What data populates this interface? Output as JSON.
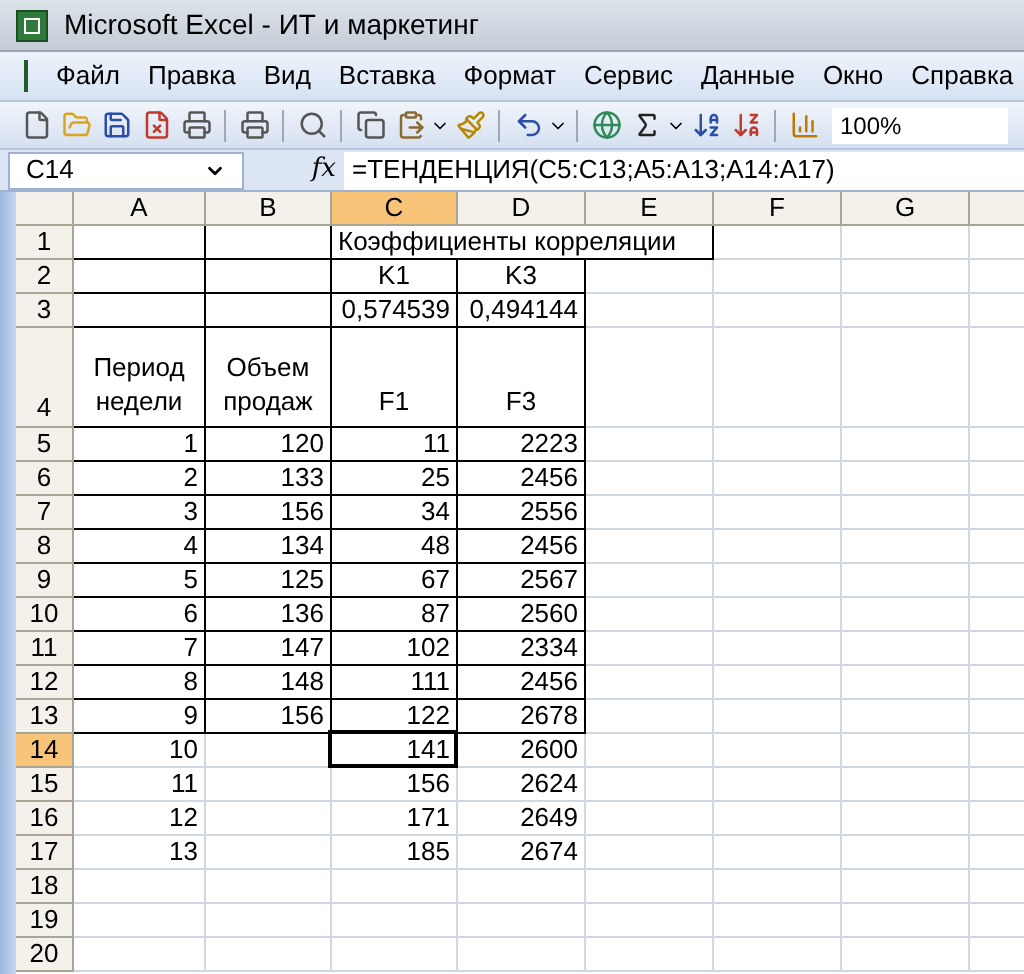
{
  "window": {
    "title": "Microsoft Excel - ИТ и маркетинг"
  },
  "menu": [
    "Файл",
    "Правка",
    "Вид",
    "Вставка",
    "Формат",
    "Сервис",
    "Данные",
    "Окно",
    "Справка"
  ],
  "toolbar": {
    "zoom": "100%"
  },
  "formula_bar": {
    "name_box": "C14",
    "fx": "fx",
    "formula": "=ТЕНДЕНЦИЯ(C5:C13;A5:A13;A14:A17)"
  },
  "columns": [
    {
      "label": "A",
      "selected": false
    },
    {
      "label": "B",
      "selected": false
    },
    {
      "label": "C",
      "selected": true
    },
    {
      "label": "D",
      "selected": false
    },
    {
      "label": "E",
      "selected": false
    },
    {
      "label": "F",
      "selected": false
    },
    {
      "label": "G",
      "selected": false
    }
  ],
  "rows": [
    {
      "number": "1",
      "selected": false,
      "kind": "span",
      "bordered": true,
      "cells": {
        "C": "Коэффициенты корреляции"
      }
    },
    {
      "number": "2",
      "selected": false,
      "kind": "center",
      "bordered": true,
      "cells": {
        "C": "K1",
        "D": "K3"
      }
    },
    {
      "number": "3",
      "selected": false,
      "kind": "number",
      "bordered": true,
      "cells": {
        "C": "0,574539",
        "D": "0,494144"
      }
    },
    {
      "number": "4",
      "selected": false,
      "kind": "tall",
      "bordered": true,
      "cells": {
        "A": "Период недели",
        "B": "Объем продаж",
        "C": "F1",
        "D": "F3"
      }
    },
    {
      "number": "5",
      "selected": false,
      "kind": "number",
      "bordered": true,
      "cells": {
        "A": "1",
        "B": "120",
        "C": "11",
        "D": "2223"
      }
    },
    {
      "number": "6",
      "selected": false,
      "kind": "number",
      "bordered": true,
      "cells": {
        "A": "2",
        "B": "133",
        "C": "25",
        "D": "2456"
      }
    },
    {
      "number": "7",
      "selected": false,
      "kind": "number",
      "bordered": true,
      "cells": {
        "A": "3",
        "B": "156",
        "C": "34",
        "D": "2556"
      }
    },
    {
      "number": "8",
      "selected": false,
      "kind": "number",
      "bordered": true,
      "cells": {
        "A": "4",
        "B": "134",
        "C": "48",
        "D": "2456"
      }
    },
    {
      "number": "9",
      "selected": false,
      "kind": "number",
      "bordered": true,
      "cells": {
        "A": "5",
        "B": "125",
        "C": "67",
        "D": "2567"
      }
    },
    {
      "number": "10",
      "selected": false,
      "kind": "number",
      "bordered": true,
      "cells": {
        "A": "6",
        "B": "136",
        "C": "87",
        "D": "2560"
      }
    },
    {
      "number": "11",
      "selected": false,
      "kind": "number",
      "bordered": true,
      "cells": {
        "A": "7",
        "B": "147",
        "C": "102",
        "D": "2334"
      }
    },
    {
      "number": "12",
      "selected": false,
      "kind": "number",
      "bordered": true,
      "cells": {
        "A": "8",
        "B": "148",
        "C": "111",
        "D": "2456"
      }
    },
    {
      "number": "13",
      "selected": false,
      "kind": "number",
      "bordered": true,
      "cells": {
        "A": "9",
        "B": "156",
        "C": "122",
        "D": "2678"
      }
    },
    {
      "number": "14",
      "selected": true,
      "kind": "number",
      "bordered": false,
      "cells": {
        "A": "10",
        "C": "141",
        "D": "2600"
      }
    },
    {
      "number": "15",
      "selected": false,
      "kind": "number",
      "bordered": false,
      "cells": {
        "A": "11",
        "C": "156",
        "D": "2624"
      }
    },
    {
      "number": "16",
      "selected": false,
      "kind": "number",
      "bordered": false,
      "cells": {
        "A": "12",
        "C": "171",
        "D": "2649"
      }
    },
    {
      "number": "17",
      "selected": false,
      "kind": "number",
      "bordered": false,
      "cells": {
        "A": "13",
        "C": "185",
        "D": "2674"
      }
    },
    {
      "number": "18",
      "selected": false,
      "kind": "number",
      "bordered": false
    },
    {
      "number": "19",
      "selected": false,
      "kind": "number",
      "bordered": false
    },
    {
      "number": "20",
      "selected": false,
      "kind": "number",
      "bordered": false
    }
  ]
}
